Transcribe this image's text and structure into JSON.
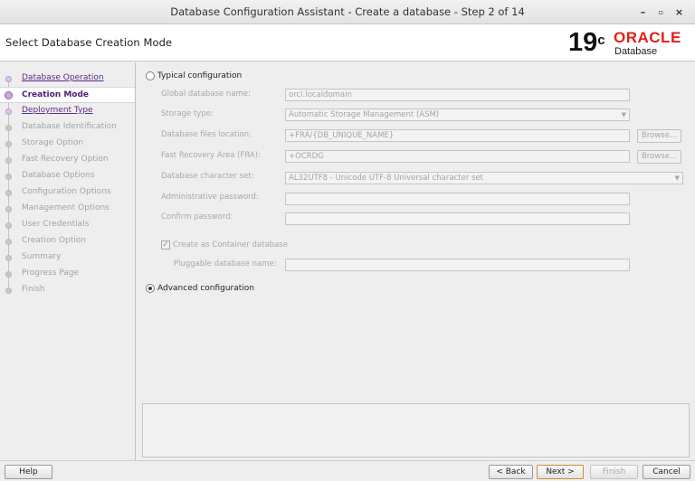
{
  "window": {
    "title": "Database Configuration Assistant - Create a database - Step 2 of 14",
    "minimize_glyph": "–",
    "maximize_glyph": "▫",
    "close_glyph": "×"
  },
  "header": {
    "page_title": "Select Database Creation Mode",
    "logo": {
      "version": "19",
      "version_sup": "c",
      "brand": "ORACLE",
      "product": "Database",
      "brand_color": "#e0201a"
    }
  },
  "steps": [
    {
      "label": "Database Operation",
      "state": "done"
    },
    {
      "label": "Creation Mode",
      "state": "current"
    },
    {
      "label": "Deployment Type",
      "state": "done"
    },
    {
      "label": "Database Identification",
      "state": "future"
    },
    {
      "label": "Storage Option",
      "state": "future"
    },
    {
      "label": "Fast Recovery Option",
      "state": "future"
    },
    {
      "label": "Database Options",
      "state": "future"
    },
    {
      "label": "Configuration Options",
      "state": "future"
    },
    {
      "label": "Management Options",
      "state": "future"
    },
    {
      "label": "User Credentials",
      "state": "future"
    },
    {
      "label": "Creation Option",
      "state": "future"
    },
    {
      "label": "Summary",
      "state": "future"
    },
    {
      "label": "Progress Page",
      "state": "future"
    },
    {
      "label": "Finish",
      "state": "future"
    }
  ],
  "typical": {
    "label": "Typical configuration",
    "selected": false,
    "global_db_name": {
      "label": "Global database name:",
      "value": "orcl.localdomain"
    },
    "storage_type": {
      "label": "Storage type:",
      "value": "Automatic Storage Management (ASM)"
    },
    "db_files_location": {
      "label": "Database files location:",
      "value": "+FRA/{DB_UNIQUE_NAME}",
      "browse": "Browse..."
    },
    "fra": {
      "label": "Fast Recovery Area (FRA):",
      "value": "+OCRDG",
      "browse": "Browse..."
    },
    "charset": {
      "label": "Database character set:",
      "value": "AL32UTF8 - Unicode UTF-8 Universal character set"
    },
    "admin_password": {
      "label": "Administrative password:",
      "value": ""
    },
    "confirm_password": {
      "label": "Confirm password:",
      "value": ""
    },
    "container": {
      "label": "Create as Container database",
      "checked": true
    },
    "pdb_name": {
      "label": "Pluggable database name:",
      "value": ""
    }
  },
  "advanced": {
    "label": "Advanced configuration",
    "selected": true
  },
  "buttons": {
    "help": "Help",
    "back": "< Back",
    "next": "Next >",
    "finish": "Finish",
    "cancel": "Cancel"
  },
  "colors": {
    "done_step": "#5b2a86",
    "current_step": "#4a2172",
    "default_button_border": "#d08a3a"
  }
}
